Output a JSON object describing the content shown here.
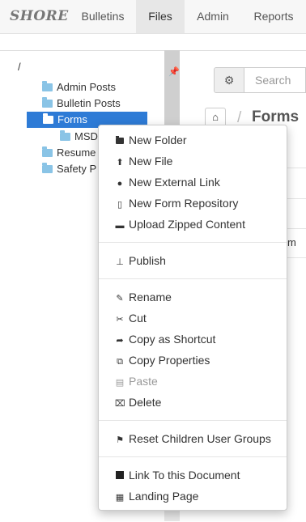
{
  "navbar": {
    "brand": "SHORE",
    "items": [
      "Bulletins",
      "Files",
      "Admin",
      "Reports"
    ]
  },
  "tree": {
    "root": "/",
    "nodes": [
      "Admin Posts",
      "Bulletin Posts",
      "Forms",
      "MSD",
      "Resume",
      "Safety P"
    ]
  },
  "toolbar": {
    "search_placeholder": "Search"
  },
  "breadcrumb": {
    "separator": "/",
    "title": "Forms"
  },
  "content_peek": "m",
  "menu": {
    "new_folder": "New Folder",
    "new_file": "New File",
    "new_external_link": "New External Link",
    "new_form_repository": "New Form Repository",
    "upload_zipped": "Upload Zipped Content",
    "publish": "Publish",
    "rename": "Rename",
    "cut": "Cut",
    "copy_shortcut": "Copy as Shortcut",
    "copy_properties": "Copy Properties",
    "paste": "Paste",
    "delete": "Delete",
    "reset_groups": "Reset Children User Groups",
    "link_document": "Link To this Document",
    "landing_page": "Landing Page"
  },
  "colors": {
    "selected": "#2e7bd6",
    "folder": "#8ac4e6"
  }
}
